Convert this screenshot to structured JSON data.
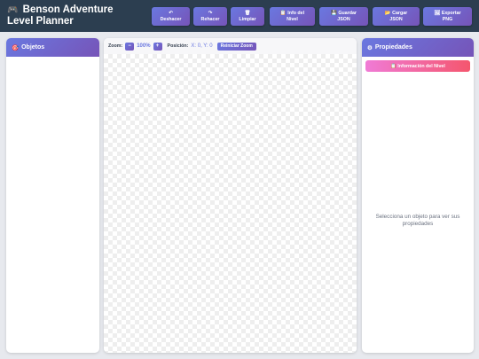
{
  "header": {
    "icon": "gamepad-icon",
    "icon_glyph": "🎮",
    "title": "Benson Adventure Level Planner"
  },
  "toolbar": {
    "buttons": [
      {
        "icon": "undo-icon",
        "glyph": "↶",
        "label": "Deshacer"
      },
      {
        "icon": "redo-icon",
        "glyph": "↷",
        "label": "Rehacer"
      },
      {
        "icon": "trash-icon",
        "glyph": "🗑",
        "label": "Limpiar"
      },
      {
        "icon": "clipboard-icon",
        "glyph": "📋",
        "label_line1": "Info del",
        "label_line2": "Nivel"
      },
      {
        "icon": "save-icon",
        "glyph": "💾",
        "label_line1": "Guardar",
        "label_line2": "JSON"
      },
      {
        "icon": "folder-icon",
        "glyph": "📂",
        "label_line1": "Cargar",
        "label_line2": "JSON"
      },
      {
        "icon": "image-icon",
        "glyph": "🖼",
        "label_line1": "Exportar",
        "label_line2": "PNG"
      }
    ]
  },
  "objects_panel": {
    "icon": "target-icon",
    "glyph": "🎯",
    "title": "Objetos"
  },
  "canvas": {
    "zoom_label": "Zoom:",
    "zoom_out": "−",
    "zoom_value": "100%",
    "zoom_in": "+",
    "position_label": "Posición:",
    "position_value": "X: 0, Y: 0",
    "reset_zoom": "Reiniciar Zoom"
  },
  "properties_panel": {
    "icon": "gear-icon",
    "glyph": "⚙",
    "title": "Propiedades",
    "level_info_icon": "clipboard-icon",
    "level_info_glyph": "📋",
    "level_info_button": "Información del Nivel",
    "empty_message": "Selecciona un objeto para ver sus propiedades"
  },
  "colors": {
    "header_bg": "#2c3e50",
    "accent_start": "#6a78e0",
    "accent_end": "#7654b8",
    "pink_start": "#f07bd6",
    "pink_end": "#f4566e"
  }
}
